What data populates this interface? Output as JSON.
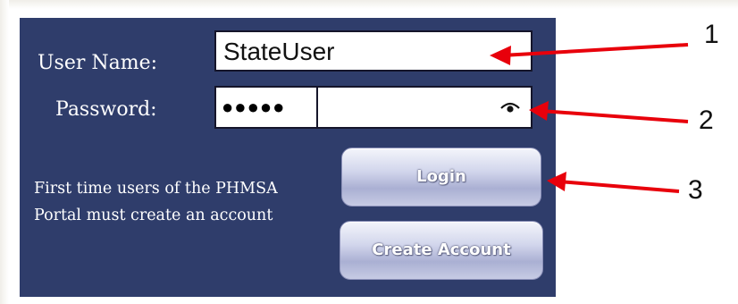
{
  "login_form": {
    "username_label": "User Name:",
    "username_value": "StateUser",
    "password_label": "Password:",
    "password_masked": "●●●●●",
    "first_time_text": "First time users of the PHMSA Portal must create an account",
    "login_button": "Login",
    "create_account_button": "Create Account"
  },
  "callouts": [
    "1",
    "2",
    "3"
  ],
  "colors": {
    "panel_background": "#2f3d6b",
    "arrow": "#e8000b"
  }
}
